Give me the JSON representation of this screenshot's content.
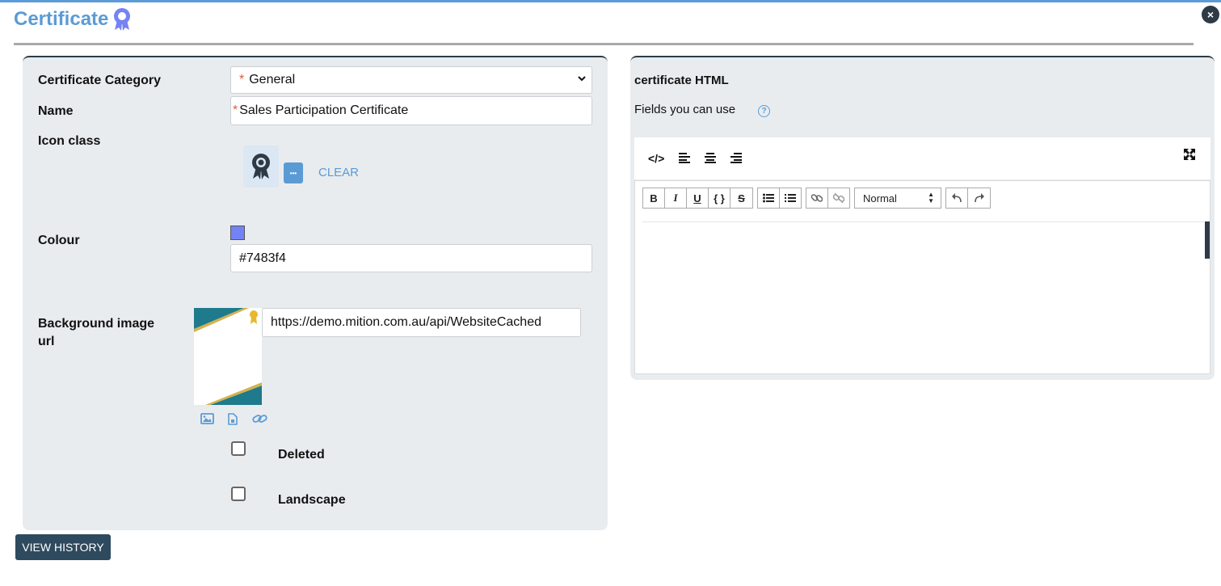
{
  "header": {
    "title": "Certificate",
    "close_label": "×",
    "accent_color": "#5b9bd5"
  },
  "form": {
    "category_label": "Certificate Category",
    "category_value": "General",
    "name_label": "Name",
    "name_value": "Sales Participation Certificate",
    "icon_label": "Icon class",
    "icon_name": "award-icon",
    "more_label": "•••",
    "clear_label": "CLEAR",
    "colour_label": "Colour",
    "colour_value": "#7483f4",
    "bg_label_line1": "Background image",
    "bg_label_line2": "url",
    "bg_url": "https://demo.mition.com.au/api/WebsiteCached",
    "deleted_label": "Deleted",
    "landscape_label": "Landscape"
  },
  "editor": {
    "title": "certificate HTML",
    "fields_label": "Fields you can use",
    "help_label": "?",
    "code_label": "</>",
    "format_value": "Normal"
  },
  "footer": {
    "view_history_label": "VIEW HISTORY"
  }
}
